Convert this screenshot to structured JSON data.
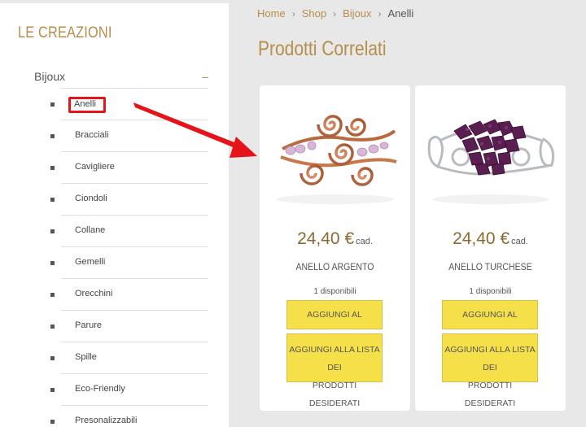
{
  "sidebar": {
    "title": "LE CREAZIONI",
    "category": {
      "label": "Bijoux",
      "toggle": "–"
    },
    "items": [
      {
        "label": "Anelli"
      },
      {
        "label": "Bracciali"
      },
      {
        "label": "Cavigliere"
      },
      {
        "label": "Ciondoli"
      },
      {
        "label": "Collane"
      },
      {
        "label": "Gemelli"
      },
      {
        "label": "Orecchini"
      },
      {
        "label": "Parure"
      },
      {
        "label": "Spille"
      },
      {
        "label": "Eco-Friendly"
      },
      {
        "label": "Presonalizzabili"
      }
    ]
  },
  "breadcrumb": {
    "home": "Home",
    "shop": "Shop",
    "bijoux": "Bijoux",
    "current": "Anelli",
    "separator": "›"
  },
  "section_title": "Prodotti Correlati",
  "products": [
    {
      "price": "24,40 €",
      "unit": "cad.",
      "name": "ANELLO ARGENTO",
      "availability": "1 disponibili",
      "cart_button": "AGGIUNGI AL CARRELLO",
      "wish_button_line1": "AGGIUNGI ALLA LISTA DEI",
      "wish_button_line2": "PRODOTTI DESIDERATI"
    },
    {
      "price": "24,40 €",
      "unit": "cad.",
      "name": "ANELLO TURCHESE",
      "availability": "1 disponibili",
      "cart_button": "AGGIUNGI AL CARRELLO",
      "wish_button_line1": "AGGIUNGI ALLA LISTA DEI",
      "wish_button_line2": "PRODOTTI DESIDERATI"
    }
  ],
  "colors": {
    "accent": "#b58e4b",
    "button": "#f6e04a",
    "highlight": "#e5141b"
  }
}
